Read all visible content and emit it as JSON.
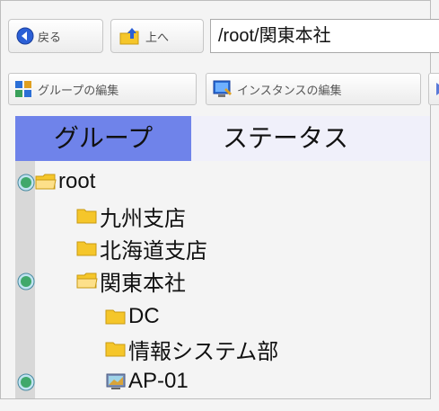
{
  "toolbar": {
    "back_label": "戻る",
    "up_label": "上へ",
    "path_value": "/root/関東本社"
  },
  "toolbar2": {
    "group_edit_label": "グループの編集",
    "instance_edit_label": "インスタンスの編集"
  },
  "tabs": [
    {
      "label": "グループ",
      "active": true
    },
    {
      "label": "ステータス",
      "active": false
    }
  ],
  "tree": {
    "items": [
      {
        "label": "root",
        "type": "folder-open",
        "status": true
      },
      {
        "label": "九州支店",
        "type": "folder",
        "status": false
      },
      {
        "label": "北海道支店",
        "type": "folder",
        "status": false
      },
      {
        "label": "関東本社",
        "type": "folder-open",
        "status": true
      },
      {
        "label": "DC",
        "type": "folder",
        "status": false
      },
      {
        "label": "情報システム部",
        "type": "folder",
        "status": false
      },
      {
        "label": "AP-01",
        "type": "instance",
        "status": true
      }
    ]
  },
  "colors": {
    "active_tab": "#6f83ea",
    "folder": "#f5c62a",
    "status_ball": "#3fa86a"
  }
}
